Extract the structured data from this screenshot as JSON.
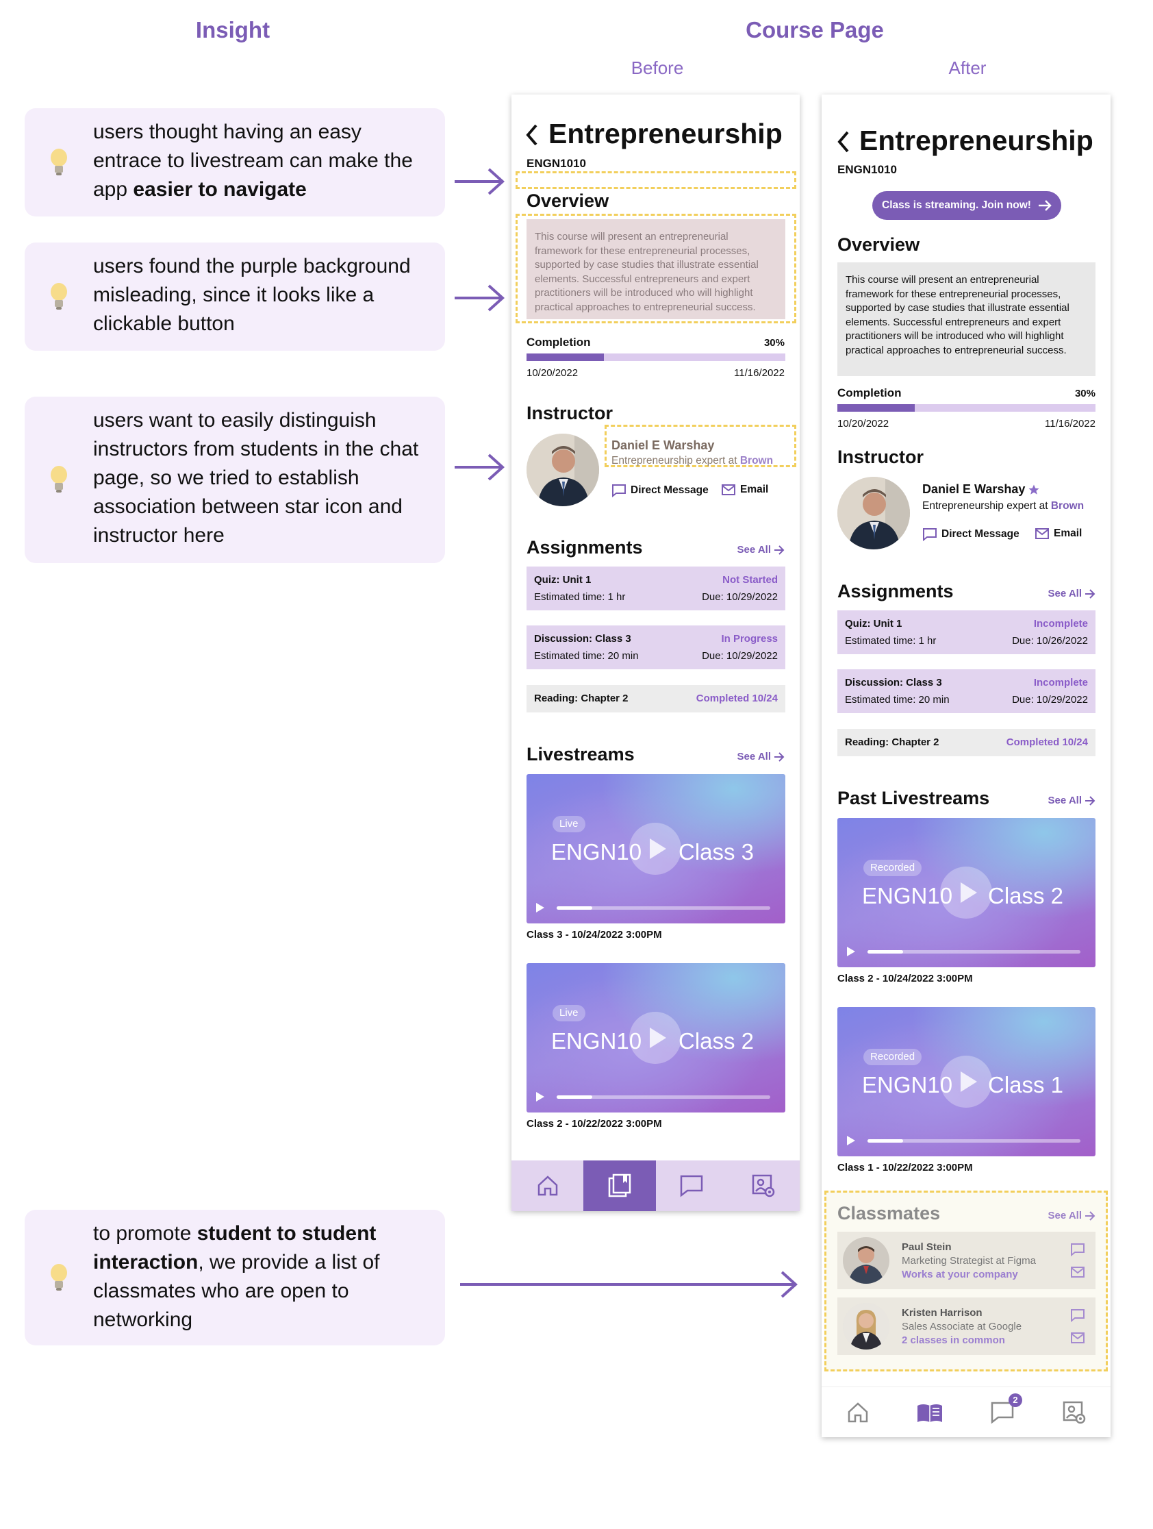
{
  "headings": {
    "insight": "Insight",
    "course_page": "Course Page",
    "before": "Before",
    "after": "After"
  },
  "insights": [
    {
      "pre": "users thought having an easy entrace to livestream can make the app ",
      "bold": "easier to navigate",
      "post": ""
    },
    {
      "pre": "users found the purple background misleading, since it looks like a clickable button",
      "bold": "",
      "post": ""
    },
    {
      "pre": "users want to easily distinguish instructors from students in the chat page, so we tried to establish association between star icon and instructor here",
      "bold": "",
      "post": ""
    },
    {
      "pre": "to promote ",
      "bold": "student to student interaction",
      "post": ", we provide a list of classmates who are open to networking"
    }
  ],
  "before": {
    "title": "Entrepreneurship",
    "code": "ENGN1010",
    "overview_heading": "Overview",
    "overview_text": "This course will present an entrepreneurial framework for these entrepreneurial processes, supported by case studies that illustrate essential elements. Successful entrepreneurs and expert practitioners will be introduced who will highlight practical approaches to entrepreneurial success.",
    "completion_label": "Completion",
    "completion_percent": "30%",
    "completion_fraction": 0.3,
    "start_date": "10/20/2022",
    "end_date": "11/16/2022",
    "instructor_heading": "Instructor",
    "instructor_name": "Daniel E Warshay",
    "instructor_role": "Entrepreneurship expert at ",
    "instructor_org": "Brown",
    "direct_message": "Direct Message",
    "email": "Email",
    "assignments_heading": "Assignments",
    "see_all": "See All",
    "assignments": [
      {
        "name": "Quiz: Unit 1",
        "status": "Not Started",
        "time": "Estimated time: 1 hr",
        "due": "Due: 10/29/2022"
      },
      {
        "name": "Discussion: Class 3",
        "status": "In Progress",
        "time": "Estimated time: 20 min",
        "due": "Due: 10/29/2022"
      },
      {
        "name": "Reading: Chapter 2",
        "status": "Completed 10/24"
      }
    ],
    "livestreams_heading": "Livestreams",
    "livestreams": [
      {
        "tag": "Live",
        "title_left": "ENGN10",
        "title_right": "Class 3",
        "caption": "Class 3 - 10/24/2022 3:00PM"
      },
      {
        "tag": "Live",
        "title_left": "ENGN10",
        "title_right": "Class 2",
        "caption": "Class 2 - 10/22/2022 3:00PM"
      }
    ],
    "active_nav": "courses"
  },
  "after": {
    "title": "Entrepreneurship",
    "code": "ENGN1010",
    "stream_button": "Class is streaming. Join now!",
    "overview_heading": "Overview",
    "overview_text": "This course will present an entrepreneurial framework for these entrepreneurial processes, supported by case studies that illustrate essential elements. Successful entrepreneurs and expert practitioners will be introduced who will highlight practical approaches to entrepreneurial success.",
    "completion_label": "Completion",
    "completion_percent": "30%",
    "completion_fraction": 0.3,
    "start_date": "10/20/2022",
    "end_date": "11/16/2022",
    "instructor_heading": "Instructor",
    "instructor_name": "Daniel E Warshay",
    "instructor_role": "Entrepreneurship expert at ",
    "instructor_org": "Brown",
    "direct_message": "Direct Message",
    "email": "Email",
    "assignments_heading": "Assignments",
    "see_all": "See All",
    "assignments": [
      {
        "name": "Quiz: Unit 1",
        "status": "Incomplete",
        "time": "Estimated time: 1 hr",
        "due": "Due: 10/26/2022"
      },
      {
        "name": "Discussion: Class 3",
        "status": "Incomplete",
        "time": "Estimated time: 20 min",
        "due": "Due: 10/29/2022"
      },
      {
        "name": "Reading: Chapter 2",
        "status": "Completed 10/24"
      }
    ],
    "livestreams_heading": "Past Livestreams",
    "livestreams": [
      {
        "tag": "Recorded",
        "title_left": "ENGN10",
        "title_right": "Class 2",
        "caption": "Class 2 - 10/24/2022 3:00PM"
      },
      {
        "tag": "Recorded",
        "title_left": "ENGN10",
        "title_right": "Class 1",
        "caption": "Class 1 - 10/22/2022 3:00PM"
      }
    ],
    "classmates_heading": "Classmates",
    "classmates": [
      {
        "name": "Paul Stein",
        "role": "Marketing Strategist at Figma",
        "note": "Works at your company"
      },
      {
        "name": "Kristen Harrison",
        "role": "Sales Associate at Google",
        "note": "2 classes in common"
      }
    ],
    "chat_badge": "2",
    "active_nav": "courses"
  },
  "colors": {
    "accent": "#7b5cb5",
    "light_purple": "#e2d4ef",
    "highlight_dash": "#f2cf5c",
    "card_bg": "#f5eefb"
  }
}
